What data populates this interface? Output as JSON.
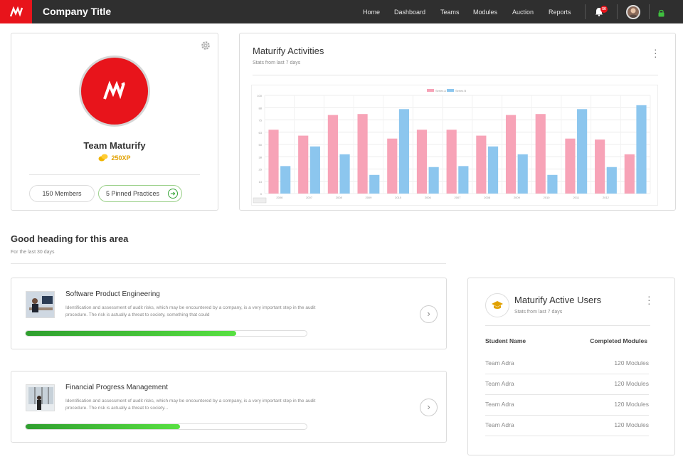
{
  "header": {
    "app_title": "Company Title",
    "nav": [
      "Home",
      "Dashboard",
      "Teams",
      "Modules",
      "Auction",
      "Reports"
    ],
    "notification_count": "50",
    "bar_color": "#2f2f2f",
    "brand_color": "#e8141b",
    "icons": [
      "logo-icon",
      "bell-icon",
      "avatar",
      "lock-icon"
    ]
  },
  "team": {
    "name": "Team Maturify",
    "xp": "250XP",
    "members_label": "150 Members",
    "pinned_label": "5 Pinned Practices"
  },
  "activity": {
    "title": "Maturify Activities",
    "subtitle": "Stats from last 7 days"
  },
  "chart_data": {
    "type": "bar",
    "categories": [
      "2006",
      "2007",
      "2008",
      "2009",
      "2010",
      "2006",
      "2007",
      "2008",
      "2009",
      "2010",
      "2011",
      "2012"
    ],
    "series": [
      {
        "name": "Series A",
        "color": "#f7a3b7",
        "values": [
          65,
          59,
          80,
          81,
          56,
          65,
          65,
          59,
          80,
          81,
          56,
          55,
          40
        ]
      },
      {
        "name": "Series B",
        "color": "#8cc6ee",
        "values": [
          28,
          48,
          40,
          19,
          86,
          27,
          28,
          48,
          40,
          19,
          86,
          27,
          90
        ]
      }
    ],
    "ylim": [
      0,
      100
    ],
    "grid": true,
    "legend": "top-center"
  },
  "section": {
    "heading": "Good heading for this area",
    "subheading": "For the last 30 days"
  },
  "courses": [
    {
      "title": "Software Product Engineering",
      "desc": "Identification and assessment of audit risks, which may be encountered by a company, is a very important step in the audit procedure. The risk is actually a threat to society, something that could",
      "progress": 0.75
    },
    {
      "title": "Financial Progress Management",
      "desc": "Identification and assessment of audit risks, which may be encountered by a company, is a very important step in the audit procedure. The risk is actually a threat to society...",
      "progress": 0.55
    }
  ],
  "users": {
    "title": "Maturify Active Users",
    "subtitle": "Stats from last 7 days",
    "col_name": "Student Name",
    "col_modules": "Completed Modules",
    "rows": [
      {
        "name": "Team Adra",
        "modules": "120 Modules"
      },
      {
        "name": "Team Adra",
        "modules": "120 Modules"
      },
      {
        "name": "Team Adra",
        "modules": "120 Modules"
      },
      {
        "name": "Team Adra",
        "modules": "120 Modules"
      }
    ]
  }
}
